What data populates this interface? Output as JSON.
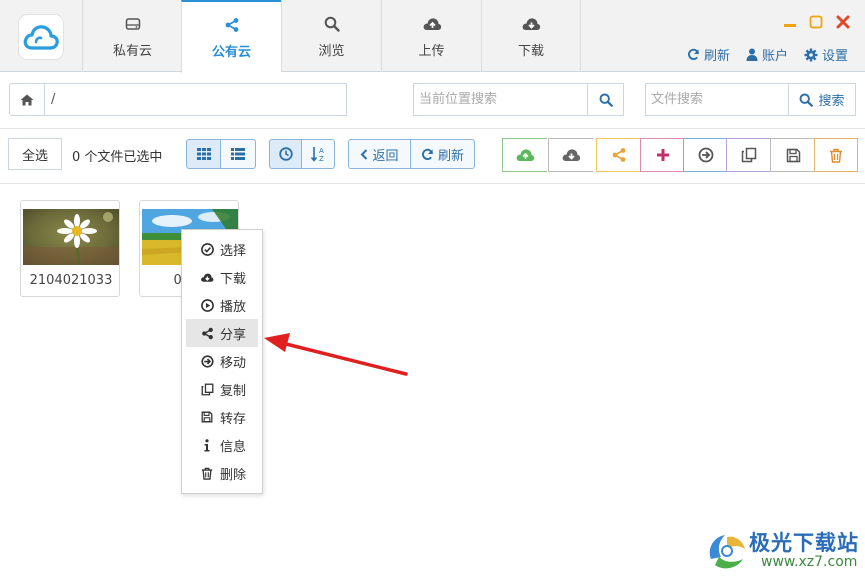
{
  "header": {
    "tabs": [
      {
        "label": "私有云",
        "icon": "hdd-icon"
      },
      {
        "label": "公有云",
        "icon": "share-icon"
      },
      {
        "label": "浏览",
        "icon": "search-icon"
      },
      {
        "label": "上传",
        "icon": "cloud-upload-icon"
      },
      {
        "label": "下载",
        "icon": "cloud-download-icon"
      }
    ],
    "active_tab": "公有云",
    "refresh_label": "刷新",
    "account_label": "账户",
    "settings_label": "设置"
  },
  "path_bar": {
    "path": "/",
    "location_search_placeholder": "当前位置搜索",
    "file_search_placeholder": "文件搜索",
    "search_label": "搜索"
  },
  "toolbar": {
    "select_all_label": "全选",
    "selection_status": "0 个文件已选中",
    "back_label": "返回",
    "refresh_label": "刷新",
    "tools": [
      "upload-icon",
      "download-icon",
      "share-icon",
      "add-icon",
      "move-icon",
      "copy-icon",
      "save-icon",
      "delete-icon"
    ]
  },
  "files": [
    {
      "name": "2104021033",
      "thumbnail": "daisy-photo"
    },
    {
      "name": "0901",
      "thumbnail": "field-photo"
    }
  ],
  "context_menu": {
    "items": [
      {
        "label": "选择",
        "icon": "check-circle-icon"
      },
      {
        "label": "下载",
        "icon": "cloud-download-icon"
      },
      {
        "label": "播放",
        "icon": "play-icon"
      },
      {
        "label": "分享",
        "icon": "share-icon"
      },
      {
        "label": "移动",
        "icon": "arrow-circle-icon"
      },
      {
        "label": "复制",
        "icon": "copy-icon"
      },
      {
        "label": "转存",
        "icon": "save-icon"
      },
      {
        "label": "信息",
        "icon": "info-icon"
      },
      {
        "label": "删除",
        "icon": "trash-icon"
      }
    ],
    "highlighted": "分享"
  },
  "watermark": {
    "title": "极光下载站",
    "url": "www.xz7.com"
  },
  "colors": {
    "accent": "#2a8fd6",
    "link": "#2c6fa8",
    "annotation_arrow": "#e02020",
    "minimize": "#f0a30a",
    "close": "#e04a2a",
    "upload_border": "#8dc78f",
    "share_border": "#f0c75e",
    "add_border": "#e08ab0",
    "move_border": "#7ab0d8",
    "copy_border": "#b8a0d6",
    "delete_border": "#e6b16a"
  }
}
